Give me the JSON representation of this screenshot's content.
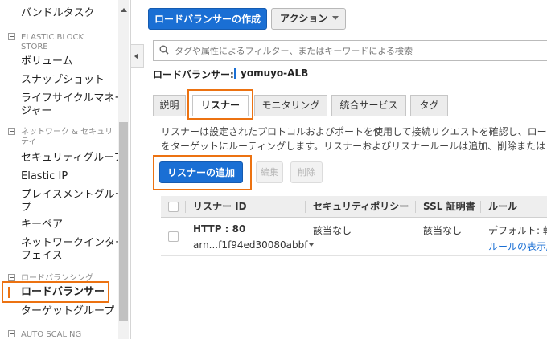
{
  "sidebar": {
    "items": [
      {
        "label": "バンドルタスク"
      },
      {
        "label": "ボリューム"
      },
      {
        "label": "スナップショット"
      },
      {
        "label": "ライフサイクルマネー"
      },
      {
        "label": "ジャー"
      },
      {
        "label": "セキュリティグループ"
      },
      {
        "label": "Elastic IP"
      },
      {
        "label": "プレイスメントグルー"
      },
      {
        "label": "プ"
      },
      {
        "label": "キーペア"
      },
      {
        "label": "ネットワークインター"
      },
      {
        "label": "フェイス"
      },
      {
        "label": "ロードバランサー"
      },
      {
        "label": "ターゲットグループ"
      }
    ],
    "sections": [
      {
        "line1": "ELASTIC BLOCK",
        "line2": "STORE"
      },
      {
        "line1": "ネットワーク & セキュリ",
        "line2": "ティ"
      },
      {
        "line1": "ロードバランシング",
        "line2": ""
      },
      {
        "line1": "AUTO SCALING",
        "line2": ""
      }
    ]
  },
  "toolbar": {
    "create_label": "ロードバランサーの作成",
    "action_label": "アクション"
  },
  "search": {
    "placeholder": "タグや属性によるフィルター、またはキーワードによる検索"
  },
  "detail": {
    "label": "ロードバランサー:",
    "name": "yomuyo-ALB"
  },
  "tabs": [
    {
      "label": "説明"
    },
    {
      "label": "リスナー"
    },
    {
      "label": "モニタリング"
    },
    {
      "label": "統合サービス"
    },
    {
      "label": "タグ"
    }
  ],
  "listeners": {
    "description_line1": "リスナーは設定されたプロトコルおよびポートを使用して接続リクエストを確認し、ロード",
    "description_line2": "をターゲットにルーティングします。リスナーおよびリスナールールは追加、削除または",
    "add_label": "リスナーの追加",
    "edit_label": "編集",
    "delete_label": "削除",
    "columns": [
      "リスナー ID",
      "セキュリティポリシー",
      "SSL 証明書",
      "ルール"
    ],
    "rows": [
      {
        "id": "HTTP : 80",
        "arn": "arn...f1f94ed30080abbf",
        "security_policy": "該当なし",
        "ssl_cert": "該当なし",
        "rule_default": "デフォルト: 転",
        "rule_link": "ルールの表示/"
      }
    ]
  },
  "colors": {
    "accent": "#1a6fd4",
    "highlight": "#ec7211"
  }
}
